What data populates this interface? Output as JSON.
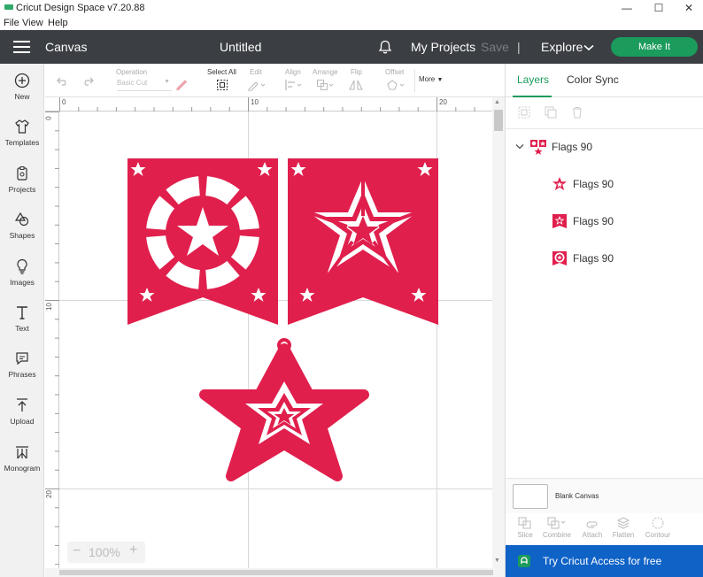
{
  "window": {
    "title": "Cricut Design Space  v7.20.88",
    "controls": [
      "—",
      "☐",
      "✕"
    ]
  },
  "menu": {
    "items": [
      "File",
      "View",
      "Help"
    ]
  },
  "header": {
    "section": "Canvas",
    "doc_title": "Untitled",
    "my_projects": "My Projects",
    "save": "Save",
    "separator": "|",
    "explore": "Explore",
    "make_it": "Make It"
  },
  "sidebar": {
    "items": [
      {
        "label": "New",
        "icon": "plus-circle-icon"
      },
      {
        "label": "Templates",
        "icon": "shirt-icon"
      },
      {
        "label": "Projects",
        "icon": "projects-icon"
      },
      {
        "label": "Shapes",
        "icon": "shapes-icon"
      },
      {
        "label": "Images",
        "icon": "lightbulb-icon"
      },
      {
        "label": "Text",
        "icon": "text-icon"
      },
      {
        "label": "Phrases",
        "icon": "speech-bubble-icon"
      },
      {
        "label": "Upload",
        "icon": "upload-icon"
      },
      {
        "label": "Monogram",
        "icon": "monogram-icon"
      }
    ]
  },
  "toolbar": {
    "operation_label": "Operation",
    "operation_value": "Basic Cut",
    "select_all": "Select All",
    "edit": "Edit",
    "align": "Align",
    "arrange": "Arrange",
    "flip": "Flip",
    "offset": "Offset",
    "more": "More"
  },
  "rulers": {
    "top": [
      "0",
      "10",
      "20"
    ],
    "left": [
      "0",
      "10",
      "20"
    ]
  },
  "zoom": {
    "value": "100%",
    "minus": "−",
    "plus": "+"
  },
  "right_panel": {
    "tabs": [
      "Layers",
      "Color Sync"
    ],
    "group": {
      "name": "Flags 90"
    },
    "layers": [
      {
        "name": "Flags 90",
        "icon": "star-icon"
      },
      {
        "name": "Flags 90",
        "icon": "flag-star-icon"
      },
      {
        "name": "Flags 90",
        "icon": "flag-circle-icon"
      }
    ],
    "blank_canvas": "Blank Canvas",
    "actions": [
      "Slice",
      "Combine",
      "Attach",
      "Flatten",
      "Contour"
    ],
    "promo": "Try Cricut Access for free"
  },
  "colors": {
    "design": "#e01f4d",
    "header_bg": "#3b3e43",
    "make_it": "#1b9b5c",
    "tab_active": "#1b9b5c",
    "promo_bg": "#0f62c6"
  }
}
